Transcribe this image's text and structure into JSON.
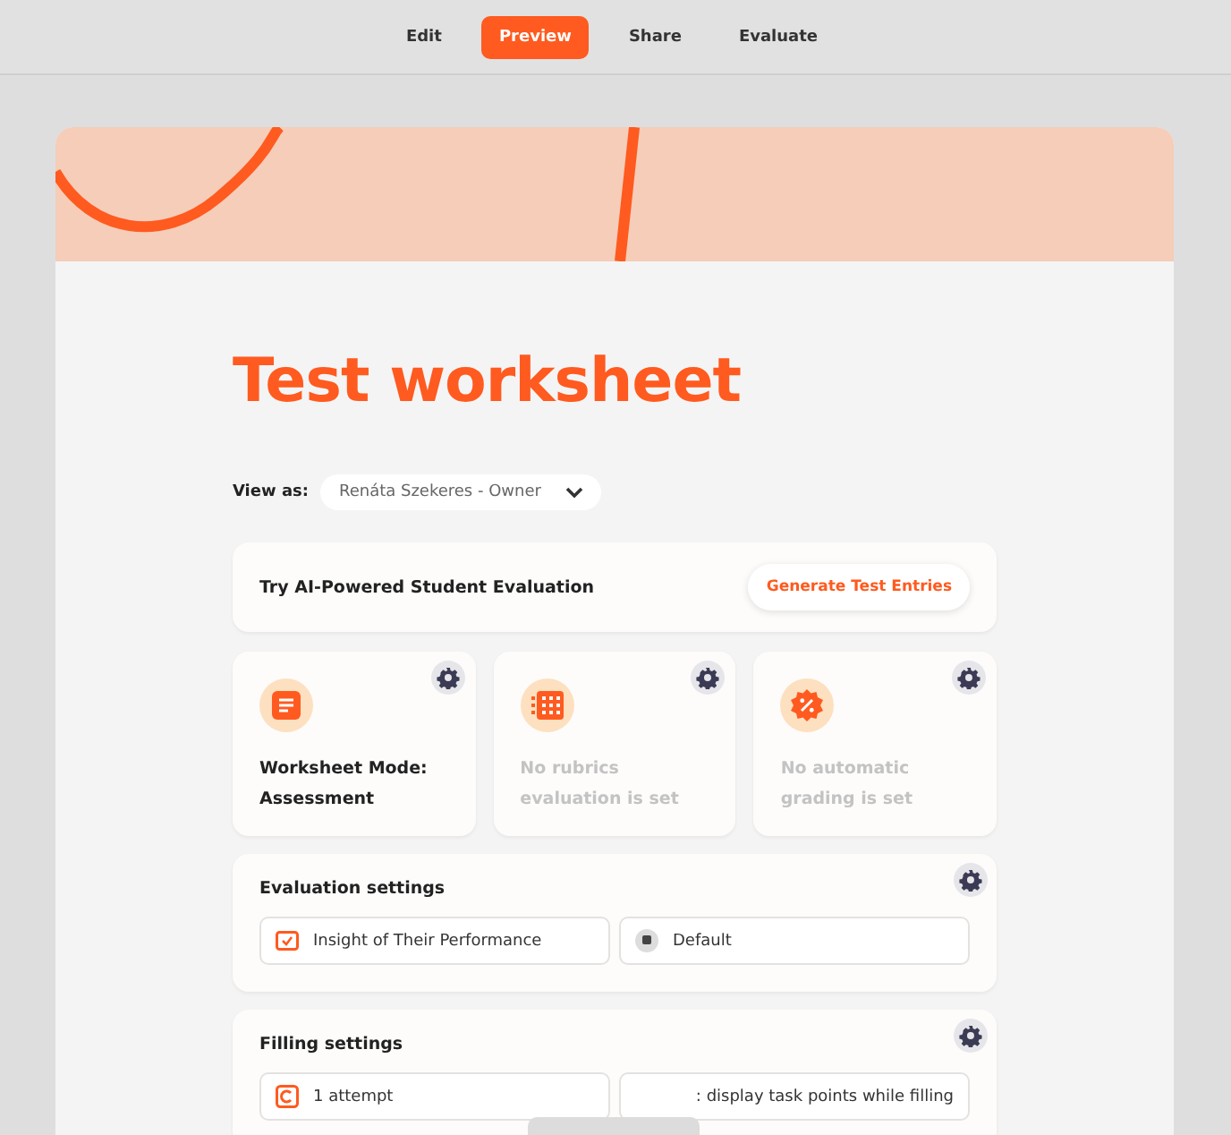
{
  "nav": {
    "tabs": [
      {
        "label": "Edit",
        "selected": false
      },
      {
        "label": "Preview",
        "selected": true
      },
      {
        "label": "Share",
        "selected": false
      },
      {
        "label": "Evaluate",
        "selected": false
      }
    ]
  },
  "worksheet": {
    "title": "Test worksheet",
    "view_as": {
      "label": "View as:",
      "value": "Renáta Szekeres - Owner"
    },
    "ai_banner": {
      "text": "Try AI-Powered Student Evaluation",
      "button": "Generate Test Entries"
    },
    "mode_cards": [
      {
        "kind": "doc",
        "text": "Worksheet Mode: Assessment",
        "disabled": false
      },
      {
        "kind": "grid",
        "text": "No rubrics evaluation is set",
        "disabled": true
      },
      {
        "kind": "percent",
        "text": "No automatic grading is set",
        "disabled": true
      }
    ],
    "sections": [
      {
        "title": "Evaluation settings",
        "items": [
          {
            "kind": "check",
            "text": "Insight of Their Performance"
          },
          {
            "kind": "badge",
            "text": "Default"
          }
        ]
      },
      {
        "title": "Filling settings",
        "items": [
          {
            "kind": "retry",
            "text": "1 attempt"
          },
          {
            "kind": "square",
            "text": ": display task points while filling"
          }
        ]
      }
    ]
  }
}
